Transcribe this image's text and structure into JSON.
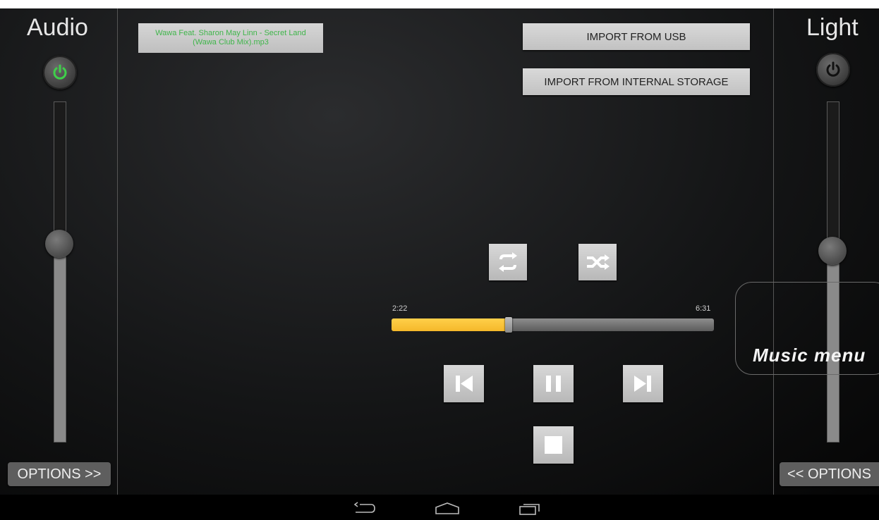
{
  "audio_panel": {
    "title": "Audio",
    "power_color": "#3fcf4a",
    "volume_level": 0.58,
    "options_label": "OPTIONS >>"
  },
  "light_panel": {
    "title": "Light",
    "power_color": "#111111",
    "level": 0.56,
    "options_label": "<< OPTIONS"
  },
  "track": {
    "name": "Wawa Feat. Sharon May Linn - Secret Land (Wawa Club Mix).mp3",
    "name_color": "#3fb54a"
  },
  "import": {
    "usb_label": "IMPORT FROM USB",
    "internal_label": "IMPORT FROM INTERNAL STORAGE"
  },
  "player": {
    "elapsed": "2:22",
    "duration": "6:31",
    "progress_fraction": 0.363,
    "progress_color": "#f5b82a",
    "buttons": [
      "repeat-icon",
      "shuffle-icon",
      "previous-icon",
      "pause-icon",
      "next-icon",
      "stop-icon"
    ]
  },
  "music_menu": {
    "label": "Music menu"
  },
  "navbar": {
    "icons": [
      "back-icon",
      "home-icon",
      "recent-apps-icon"
    ]
  }
}
